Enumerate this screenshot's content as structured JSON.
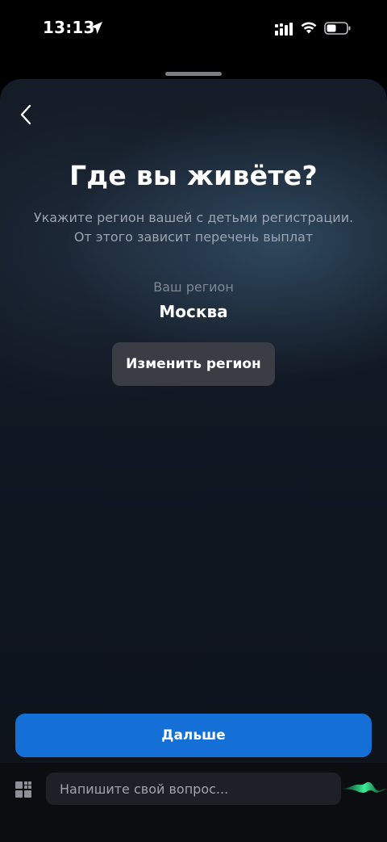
{
  "status_bar": {
    "time": "13:13",
    "icons": [
      "location-arrow-icon",
      "signal-icon",
      "wifi-icon",
      "battery-icon"
    ]
  },
  "sheet": {
    "back_icon": "chevron-left-icon",
    "title": "Где вы живёте?",
    "subtitle_line1": "Укажите регион вашей с детьми регистрации.",
    "subtitle_line2": "От этого зависит перечень выплат",
    "region_label": "Ваш регион",
    "region_value": "Москва",
    "change_region_label": "Изменить регион",
    "next_label": "Дальше"
  },
  "assistant_bar": {
    "menu_icon": "grid-icon",
    "input_placeholder": "Напишите свой вопрос...",
    "voice_icon": "voice-wave-icon"
  },
  "colors": {
    "accent": "#1470d6",
    "voice_wave": "#34e08a",
    "secondary_button": "#3a3d44"
  }
}
